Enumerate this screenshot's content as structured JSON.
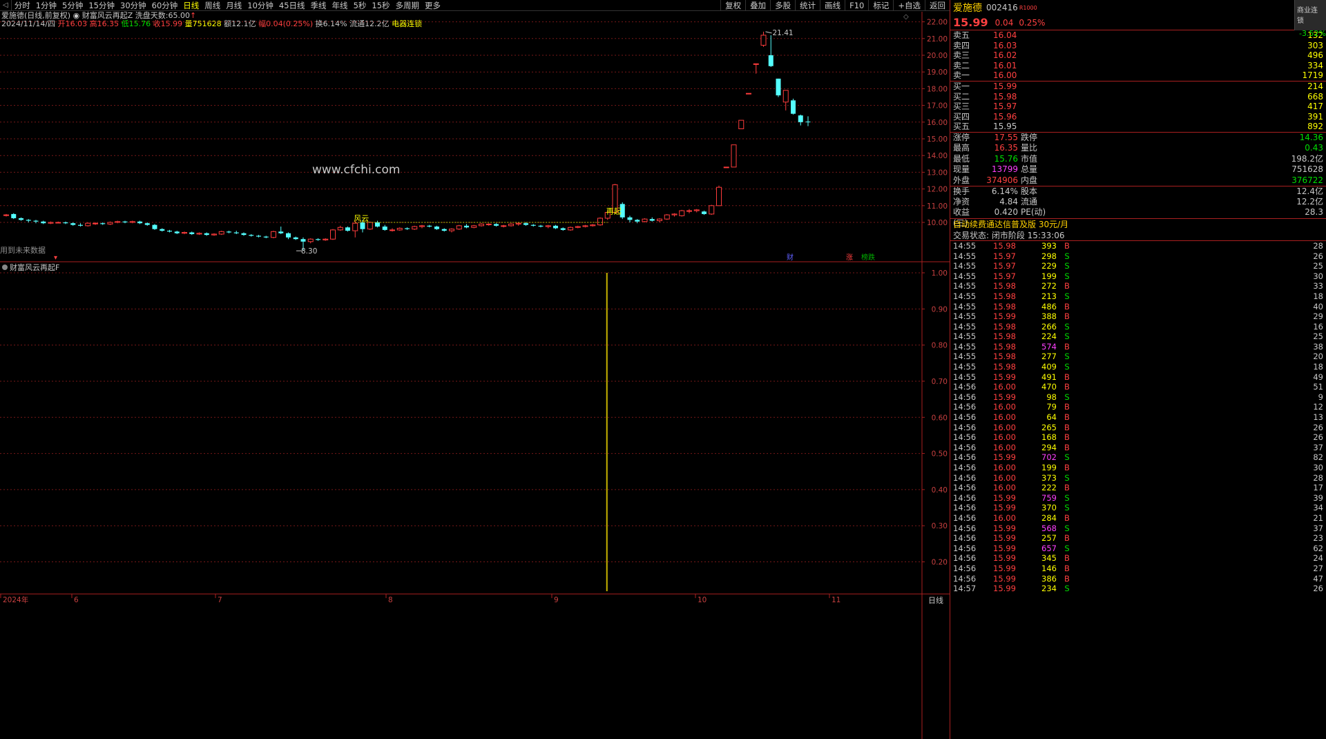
{
  "toolbar": {
    "periods": [
      "分时",
      "1分钟",
      "5分钟",
      "15分钟",
      "30分钟",
      "60分钟",
      "日线",
      "周线",
      "月线",
      "10分钟",
      "45日线",
      "季线",
      "年线",
      "5秒",
      "15秒",
      "多周期",
      "更多"
    ],
    "active": "日线",
    "right": [
      "复权",
      "叠加",
      "多股",
      "统计",
      "画线",
      "F10",
      "标记",
      "+自选",
      "返回"
    ]
  },
  "info_line1": {
    "stock": "爱施德(日线,前复权)",
    "indicator": "财富风云再起Z",
    "wash_label": "洗盘天数:",
    "wash_value": "65.00"
  },
  "info_line2": {
    "date": "2024/11/14/四",
    "open": "开16.03",
    "high": "高16.35",
    "low": "低15.76",
    "close": "收15.99",
    "vol": "量751628",
    "amt": "额12.1亿",
    "range": "幅0.04(0.25%)",
    "turn": "换6.14%",
    "float": "流通12.2亿",
    "sector": "电器连锁"
  },
  "watermark": "www.cfchi.com",
  "main_chart": {
    "y_ticks": [
      "22.00",
      "21.00",
      "20.00",
      "19.00",
      "18.00",
      "17.00",
      "16.00",
      "15.00",
      "14.00",
      "13.00",
      "12.00",
      "11.00",
      "10.00"
    ],
    "annot_fengyun": "风云",
    "annot_zaiqi": "再起",
    "annot_high": "21.41",
    "annot_low": "8.30",
    "future_note": "用到未来数据",
    "badges": [
      "财",
      "涨",
      "榜跌"
    ]
  },
  "sub_chart": {
    "title": "财富风云再起F",
    "y_ticks": [
      "1.00",
      "0.90",
      "0.80",
      "0.70",
      "0.60",
      "0.50",
      "0.40",
      "0.30",
      "0.20"
    ]
  },
  "x_axis": {
    "labels": [
      "2024年",
      "6",
      "7",
      "8",
      "9",
      "10",
      "11"
    ],
    "period_label": "日线"
  },
  "quote": {
    "name": "爱施德",
    "code": "002416",
    "rz": "R1000",
    "biz_title": "商业连锁",
    "biz_change": "-3.52%",
    "price": "15.99",
    "change": "0.04",
    "pct": "0.25%",
    "sells": [
      {
        "label": "卖五",
        "price": "16.04",
        "vol": "132"
      },
      {
        "label": "卖四",
        "price": "16.03",
        "vol": "303"
      },
      {
        "label": "卖三",
        "price": "16.02",
        "vol": "496"
      },
      {
        "label": "卖二",
        "price": "16.01",
        "vol": "334"
      },
      {
        "label": "卖一",
        "price": "16.00",
        "vol": "1719"
      }
    ],
    "buys": [
      {
        "label": "买一",
        "price": "15.99",
        "vol": "214"
      },
      {
        "label": "买二",
        "price": "15.98",
        "vol": "668"
      },
      {
        "label": "买三",
        "price": "15.97",
        "vol": "417"
      },
      {
        "label": "买四",
        "price": "15.96",
        "vol": "391"
      },
      {
        "label": "买五",
        "price": "15.95",
        "vol": "892"
      }
    ],
    "stats": [
      {
        "l1": "涨停",
        "v1": "17.55",
        "c1": "r",
        "l2": "跌停",
        "v2": "14.36",
        "c2": "g"
      },
      {
        "l1": "最高",
        "v1": "16.35",
        "c1": "r",
        "l2": "量比",
        "v2": "0.43",
        "c2": "g"
      },
      {
        "l1": "最低",
        "v1": "15.76",
        "c1": "g",
        "l2": "市值",
        "v2": "198.2亿",
        "c2": "w"
      },
      {
        "l1": "现量",
        "v1": "13799",
        "c1": "m",
        "l2": "总量",
        "v2": "751628",
        "c2": "w"
      },
      {
        "l1": "外盘",
        "v1": "374906",
        "c1": "r",
        "l2": "内盘",
        "v2": "376722",
        "c2": "g"
      },
      {
        "l1": "换手",
        "v1": "6.14%",
        "c1": "w",
        "l2": "股本",
        "v2": "12.4亿",
        "c2": "w"
      },
      {
        "l1": "净资",
        "v1": "4.84",
        "c1": "w",
        "l2": "流通",
        "v2": "12.2亿",
        "c2": "w"
      },
      {
        "l1": "收益(三)",
        "v1": "0.420",
        "c1": "w",
        "l2": "PE(动)",
        "v2": "28.3",
        "c2": "w"
      }
    ],
    "ad": "自动续费通达信普及版 30元/月",
    "status": "交易状态: 闭市阶段 15:33:06"
  },
  "ticks": [
    [
      "14:55",
      "15.98",
      "393",
      "B",
      "28"
    ],
    [
      "14:55",
      "15.97",
      "298",
      "S",
      "26"
    ],
    [
      "14:55",
      "15.97",
      "229",
      "S",
      "25"
    ],
    [
      "14:55",
      "15.97",
      "199",
      "S",
      "30"
    ],
    [
      "14:55",
      "15.98",
      "272",
      "B",
      "33"
    ],
    [
      "14:55",
      "15.98",
      "213",
      "S",
      "18"
    ],
    [
      "14:55",
      "15.98",
      "486",
      "B",
      "40"
    ],
    [
      "14:55",
      "15.99",
      "388",
      "B",
      "29"
    ],
    [
      "14:55",
      "15.98",
      "266",
      "S",
      "16"
    ],
    [
      "14:55",
      "15.98",
      "224",
      "S",
      "25"
    ],
    [
      "14:55",
      "15.98",
      "574",
      "B",
      "38"
    ],
    [
      "14:55",
      "15.98",
      "277",
      "S",
      "20"
    ],
    [
      "14:55",
      "15.98",
      "409",
      "S",
      "18"
    ],
    [
      "14:55",
      "15.99",
      "491",
      "B",
      "49"
    ],
    [
      "14:56",
      "16.00",
      "470",
      "B",
      "51"
    ],
    [
      "14:56",
      "15.99",
      "98",
      "S",
      "9"
    ],
    [
      "14:56",
      "16.00",
      "79",
      "B",
      "12"
    ],
    [
      "14:56",
      "16.00",
      "64",
      "B",
      "13"
    ],
    [
      "14:56",
      "16.00",
      "265",
      "B",
      "26"
    ],
    [
      "14:56",
      "16.00",
      "168",
      "B",
      "26"
    ],
    [
      "14:56",
      "16.00",
      "294",
      "B",
      "37"
    ],
    [
      "14:56",
      "15.99",
      "702",
      "S",
      "82"
    ],
    [
      "14:56",
      "16.00",
      "199",
      "B",
      "30"
    ],
    [
      "14:56",
      "16.00",
      "373",
      "S",
      "28"
    ],
    [
      "14:56",
      "16.00",
      "222",
      "B",
      "17"
    ],
    [
      "14:56",
      "15.99",
      "759",
      "S",
      "39"
    ],
    [
      "14:56",
      "15.99",
      "370",
      "S",
      "34"
    ],
    [
      "14:56",
      "16.00",
      "284",
      "B",
      "21"
    ],
    [
      "14:56",
      "15.99",
      "568",
      "S",
      "37"
    ],
    [
      "14:56",
      "15.99",
      "257",
      "B",
      "23"
    ],
    [
      "14:56",
      "15.99",
      "657",
      "S",
      "62"
    ],
    [
      "14:56",
      "15.99",
      "345",
      "B",
      "24"
    ],
    [
      "14:56",
      "15.99",
      "146",
      "B",
      "27"
    ],
    [
      "14:56",
      "15.99",
      "386",
      "B",
      "47"
    ],
    [
      "14:57",
      "15.99",
      "234",
      "S",
      "26"
    ]
  ],
  "colors": {
    "up": "#ff3c3c",
    "down": "#54ffff",
    "grid": "#7a1818",
    "axis": "#aa2020",
    "signal": "#c8b400"
  },
  "candles": [
    [
      10.45,
      10.5,
      10.35,
      10.45
    ],
    [
      10.5,
      10.55,
      10.2,
      10.25
    ],
    [
      10.25,
      10.3,
      10.1,
      10.15
    ],
    [
      10.15,
      10.2,
      10.0,
      10.1
    ],
    [
      10.1,
      10.15,
      9.95,
      10.05
    ],
    [
      10.05,
      10.1,
      9.9,
      9.95
    ],
    [
      9.95,
      10.05,
      9.9,
      10.0
    ],
    [
      10.0,
      10.05,
      9.95,
      10.0
    ],
    [
      10.0,
      10.05,
      9.9,
      9.95
    ],
    [
      9.95,
      10.0,
      9.8,
      9.85
    ],
    [
      9.85,
      9.95,
      9.75,
      9.8
    ],
    [
      9.8,
      10.0,
      9.75,
      9.95
    ],
    [
      9.95,
      10.0,
      9.85,
      9.95
    ],
    [
      9.95,
      10.0,
      9.85,
      9.9
    ],
    [
      9.9,
      10.05,
      9.85,
      10.0
    ],
    [
      10.0,
      10.1,
      9.95,
      10.05
    ],
    [
      10.05,
      10.1,
      9.95,
      10.0
    ],
    [
      10.0,
      10.1,
      9.95,
      10.05
    ],
    [
      10.05,
      10.1,
      9.9,
      9.95
    ],
    [
      9.95,
      10.0,
      9.8,
      9.85
    ],
    [
      9.85,
      9.9,
      9.55,
      9.6
    ],
    [
      9.6,
      9.65,
      9.45,
      9.5
    ],
    [
      9.5,
      9.55,
      9.4,
      9.45
    ],
    [
      9.45,
      9.5,
      9.3,
      9.35
    ],
    [
      9.35,
      9.45,
      9.3,
      9.4
    ],
    [
      9.4,
      9.45,
      9.25,
      9.3
    ],
    [
      9.3,
      9.4,
      9.25,
      9.35
    ],
    [
      9.35,
      9.4,
      9.2,
      9.25
    ],
    [
      9.25,
      9.35,
      9.2,
      9.3
    ],
    [
      9.3,
      9.5,
      9.25,
      9.45
    ],
    [
      9.45,
      9.5,
      9.35,
      9.4
    ],
    [
      9.4,
      9.5,
      9.3,
      9.35
    ],
    [
      9.35,
      9.4,
      9.2,
      9.25
    ],
    [
      9.25,
      9.3,
      9.15,
      9.2
    ],
    [
      9.2,
      9.25,
      9.1,
      9.15
    ],
    [
      9.15,
      9.2,
      9.05,
      9.1
    ],
    [
      9.1,
      9.5,
      9.05,
      9.45
    ],
    [
      9.45,
      9.75,
      9.3,
      9.35
    ],
    [
      9.35,
      9.4,
      9.0,
      9.1
    ],
    [
      9.1,
      9.15,
      8.95,
      9.0
    ],
    [
      9.0,
      9.1,
      8.3,
      8.85
    ],
    [
      8.85,
      9.05,
      8.75,
      9.0
    ],
    [
      9.0,
      9.05,
      8.9,
      8.95
    ],
    [
      8.95,
      9.05,
      8.9,
      9.0
    ],
    [
      9.0,
      9.6,
      8.95,
      9.55
    ],
    [
      9.55,
      9.8,
      9.5,
      9.7
    ],
    [
      9.7,
      9.75,
      9.45,
      9.5
    ],
    [
      9.5,
      10.1,
      9.1,
      9.95
    ],
    [
      10.0,
      10.15,
      9.4,
      9.6
    ],
    [
      9.6,
      10.05,
      9.55,
      10.0
    ],
    [
      10.0,
      10.1,
      9.7,
      9.75
    ],
    [
      9.75,
      9.85,
      9.5,
      9.55
    ],
    [
      9.55,
      9.65,
      9.45,
      9.55
    ],
    [
      9.55,
      9.7,
      9.5,
      9.65
    ],
    [
      9.65,
      9.7,
      9.55,
      9.6
    ],
    [
      9.6,
      9.8,
      9.55,
      9.75
    ],
    [
      9.75,
      9.85,
      9.65,
      9.8
    ],
    [
      9.8,
      9.85,
      9.7,
      9.75
    ],
    [
      9.75,
      9.8,
      9.55,
      9.6
    ],
    [
      9.6,
      9.65,
      9.45,
      9.5
    ],
    [
      9.5,
      9.65,
      9.4,
      9.6
    ],
    [
      9.6,
      9.85,
      9.55,
      9.8
    ],
    [
      9.8,
      9.9,
      9.65,
      9.7
    ],
    [
      9.7,
      9.85,
      9.65,
      9.8
    ],
    [
      9.8,
      9.95,
      9.75,
      9.9
    ],
    [
      9.9,
      9.95,
      9.8,
      9.9
    ],
    [
      9.9,
      9.95,
      9.75,
      9.8
    ],
    [
      9.8,
      9.85,
      9.7,
      9.8
    ],
    [
      9.8,
      9.95,
      9.75,
      9.9
    ],
    [
      9.9,
      10.0,
      9.8,
      9.95
    ],
    [
      9.95,
      10.0,
      9.8,
      9.85
    ],
    [
      9.85,
      9.9,
      9.75,
      9.8
    ],
    [
      9.8,
      9.85,
      9.7,
      9.75
    ],
    [
      9.75,
      9.85,
      9.65,
      9.8
    ],
    [
      9.8,
      9.85,
      9.6,
      9.65
    ],
    [
      9.65,
      9.7,
      9.5,
      9.55
    ],
    [
      9.55,
      9.75,
      9.5,
      9.7
    ],
    [
      9.7,
      9.8,
      9.65,
      9.75
    ],
    [
      9.75,
      9.85,
      9.7,
      9.8
    ],
    [
      9.8,
      9.9,
      9.75,
      9.85
    ],
    [
      9.85,
      10.3,
      9.8,
      10.25
    ],
    [
      10.25,
      10.7,
      10.15,
      10.6
    ],
    [
      10.6,
      12.3,
      10.55,
      12.25
    ],
    [
      11.1,
      11.2,
      10.2,
      10.3
    ],
    [
      10.3,
      10.4,
      10.0,
      10.15
    ],
    [
      10.15,
      10.2,
      9.95,
      10.05
    ],
    [
      10.05,
      10.25,
      10.0,
      10.2
    ],
    [
      10.2,
      10.3,
      10.05,
      10.1
    ],
    [
      10.1,
      10.25,
      10.0,
      10.2
    ],
    [
      10.2,
      10.5,
      10.15,
      10.45
    ],
    [
      10.45,
      10.55,
      10.35,
      10.5
    ],
    [
      10.4,
      10.75,
      10.35,
      10.7
    ],
    [
      10.7,
      10.8,
      10.55,
      10.7
    ],
    [
      10.7,
      10.8,
      10.6,
      10.75
    ],
    [
      10.65,
      10.7,
      10.45,
      10.5
    ],
    [
      10.5,
      11.05,
      10.45,
      11.0
    ],
    [
      11.0,
      12.2,
      11.0,
      12.1
    ],
    [
      13.31,
      13.31,
      13.31,
      13.31
    ],
    [
      13.31,
      14.64,
      13.31,
      14.64
    ],
    [
      15.6,
      16.11,
      15.6,
      16.11
    ],
    [
      17.72,
      17.72,
      17.72,
      17.72
    ],
    [
      19.49,
      19.49,
      18.9,
      19.49
    ],
    [
      20.6,
      21.41,
      20.5,
      21.2
    ],
    [
      20.0,
      21.2,
      19.3,
      19.35
    ],
    [
      18.6,
      18.6,
      17.5,
      17.6
    ],
    [
      17.2,
      17.9,
      16.7,
      17.9
    ],
    [
      17.3,
      17.4,
      16.45,
      16.5
    ],
    [
      16.4,
      16.45,
      15.8,
      16.0
    ],
    [
      16.03,
      16.35,
      15.76,
      15.99
    ]
  ]
}
